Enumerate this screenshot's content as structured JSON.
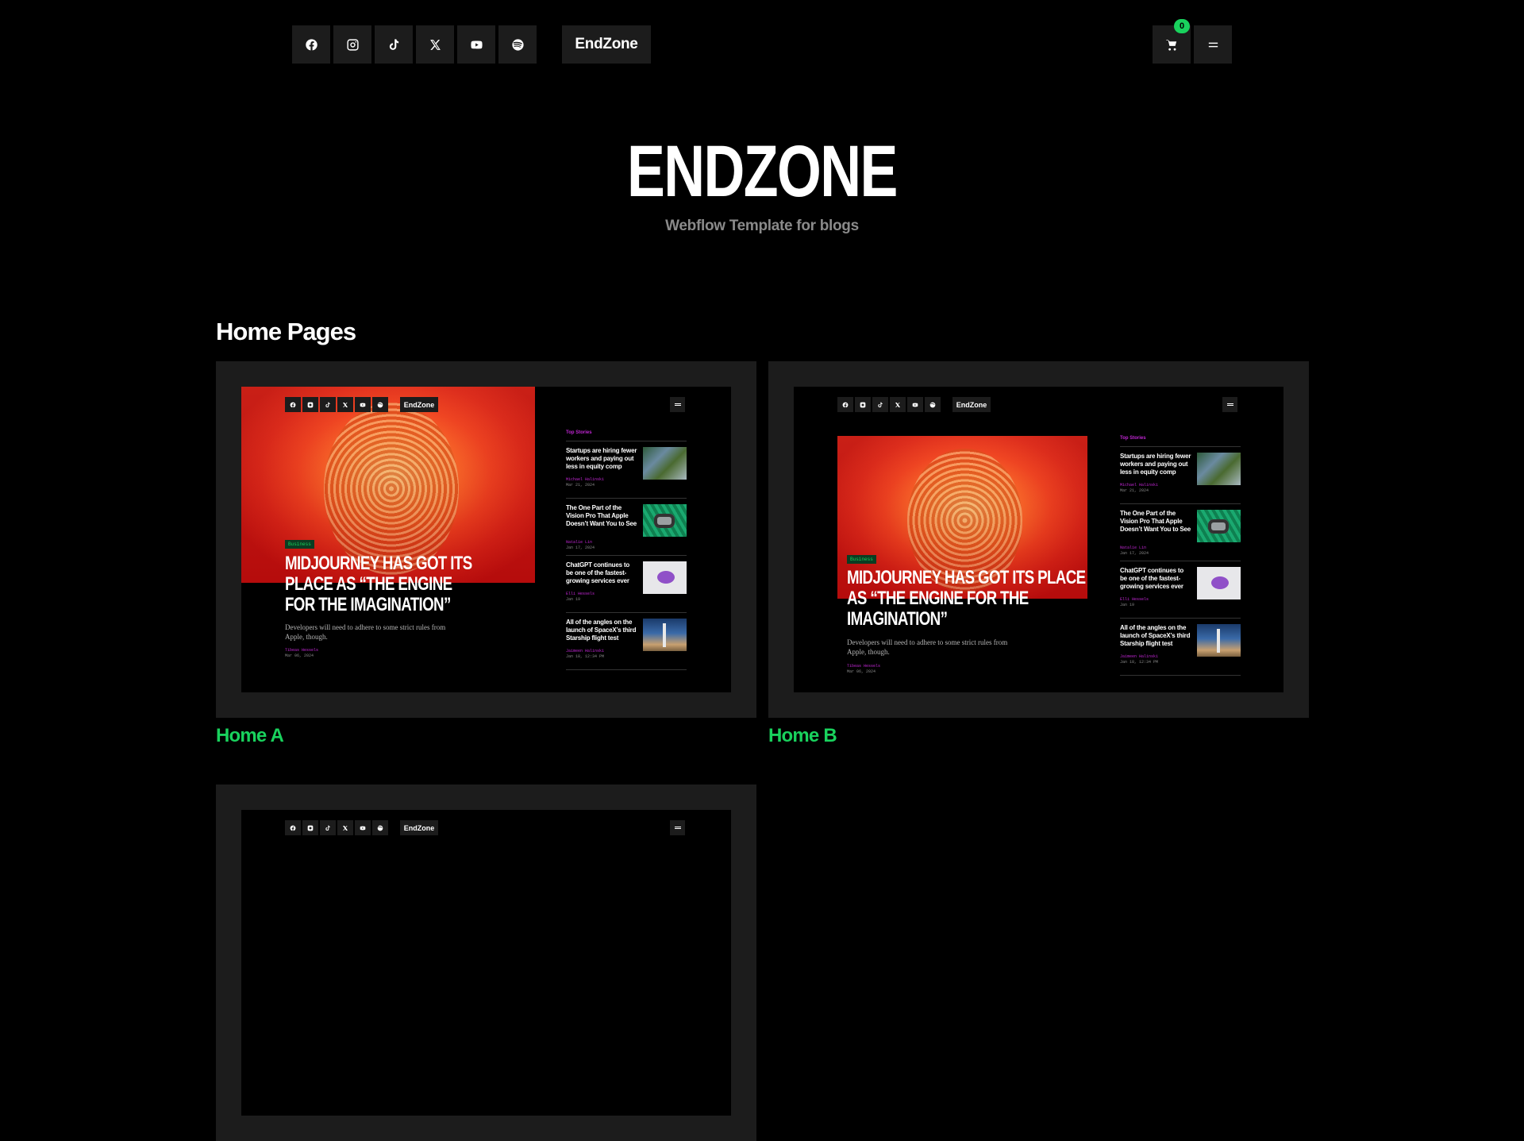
{
  "header": {
    "social": [
      {
        "name": "facebook",
        "icon": "facebook-icon"
      },
      {
        "name": "instagram",
        "icon": "instagram-icon"
      },
      {
        "name": "tiktok",
        "icon": "tiktok-icon"
      },
      {
        "name": "x",
        "icon": "x-icon"
      },
      {
        "name": "youtube",
        "icon": "youtube-icon"
      },
      {
        "name": "spotify",
        "icon": "spotify-icon"
      }
    ],
    "brand": "EndZone",
    "cart_count": "0",
    "cart_icon": "cart-icon",
    "menu_icon": "menu-icon"
  },
  "hero": {
    "logo": "ENDZONE",
    "subtitle": "Webflow Template for blogs"
  },
  "section": {
    "title": "Home Pages"
  },
  "preview": {
    "brand": "EndZone",
    "category": "Business",
    "headline": "MIDJOURNEY HAS GOT ITS PLACE AS “THE ENGINE FOR THE IMAGINATION”",
    "excerpt": "Developers will need to adhere to some strict rules from Apple, though.",
    "author": "Tibeas Hessels",
    "date": "Mar 06, 2024",
    "top_stories_label": "Top Stories",
    "stories": [
      {
        "title": "Startups are hiring fewer workers and paying out less in equity comp",
        "author": "Michael Halinski",
        "date": "Mar 21, 2024"
      },
      {
        "title": "The One Part of the Vision Pro That Apple Doesn’t Want You to See",
        "author": "Natalie Lin",
        "date": "Jan 17, 2024"
      },
      {
        "title": "ChatGPT continues to be one of the fastest-growing services ever",
        "author": "Elli Hessels",
        "date": "Jan 19"
      },
      {
        "title": "All of the angles on the launch of SpaceX’s third Starship flight test",
        "author": "Jaimeen Halinski",
        "date": "Jan 18, 12:34 PM"
      }
    ]
  },
  "cards": [
    {
      "label": "Home A",
      "variant": "a"
    },
    {
      "label": "Home B",
      "variant": "b"
    },
    {
      "label": "",
      "variant": "c"
    }
  ],
  "colors": {
    "background": "#000000",
    "panel": "#1c1c1c",
    "accent_green": "#19d25d",
    "accent_magenta": "#c026d3"
  }
}
